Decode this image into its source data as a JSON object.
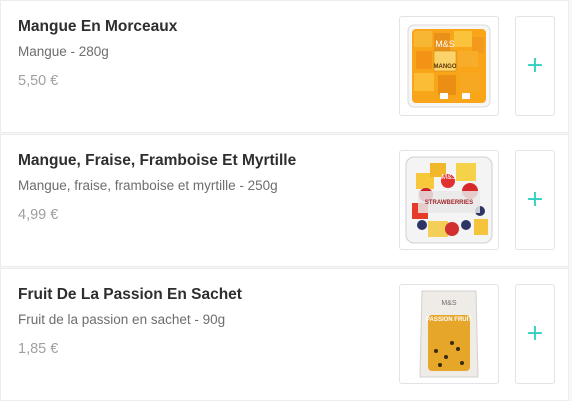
{
  "products": [
    {
      "name": "Mangue En Morceaux",
      "description": "Mangue - 280g",
      "price": "5,50 €",
      "image_icon": "mango-chunks-pack",
      "pack_brand": "M&S",
      "pack_label": "MANGO"
    },
    {
      "name": "Mangue, Fraise, Framboise Et Myrtille",
      "description": "Mangue, fraise, framboise et myrtille - 250g",
      "price": "4,99 €",
      "image_icon": "mixed-fruit-pot",
      "pack_brand": "M&S",
      "pack_label": "STRAWBERRIES"
    },
    {
      "name": "Fruit De La Passion En Sachet",
      "description": "Fruit de la passion en sachet - 90g",
      "price": "1,85 €",
      "image_icon": "passion-fruit-pouch",
      "pack_brand": "M&S",
      "pack_label": "PASSION FRUIT"
    }
  ],
  "add_button_icon": "plus-icon",
  "add_button_glyph": "+",
  "colors": {
    "accent": "#2ecfbe",
    "title": "#2e2e2e",
    "description": "#6d6d6d",
    "price": "#a0a0a0"
  }
}
